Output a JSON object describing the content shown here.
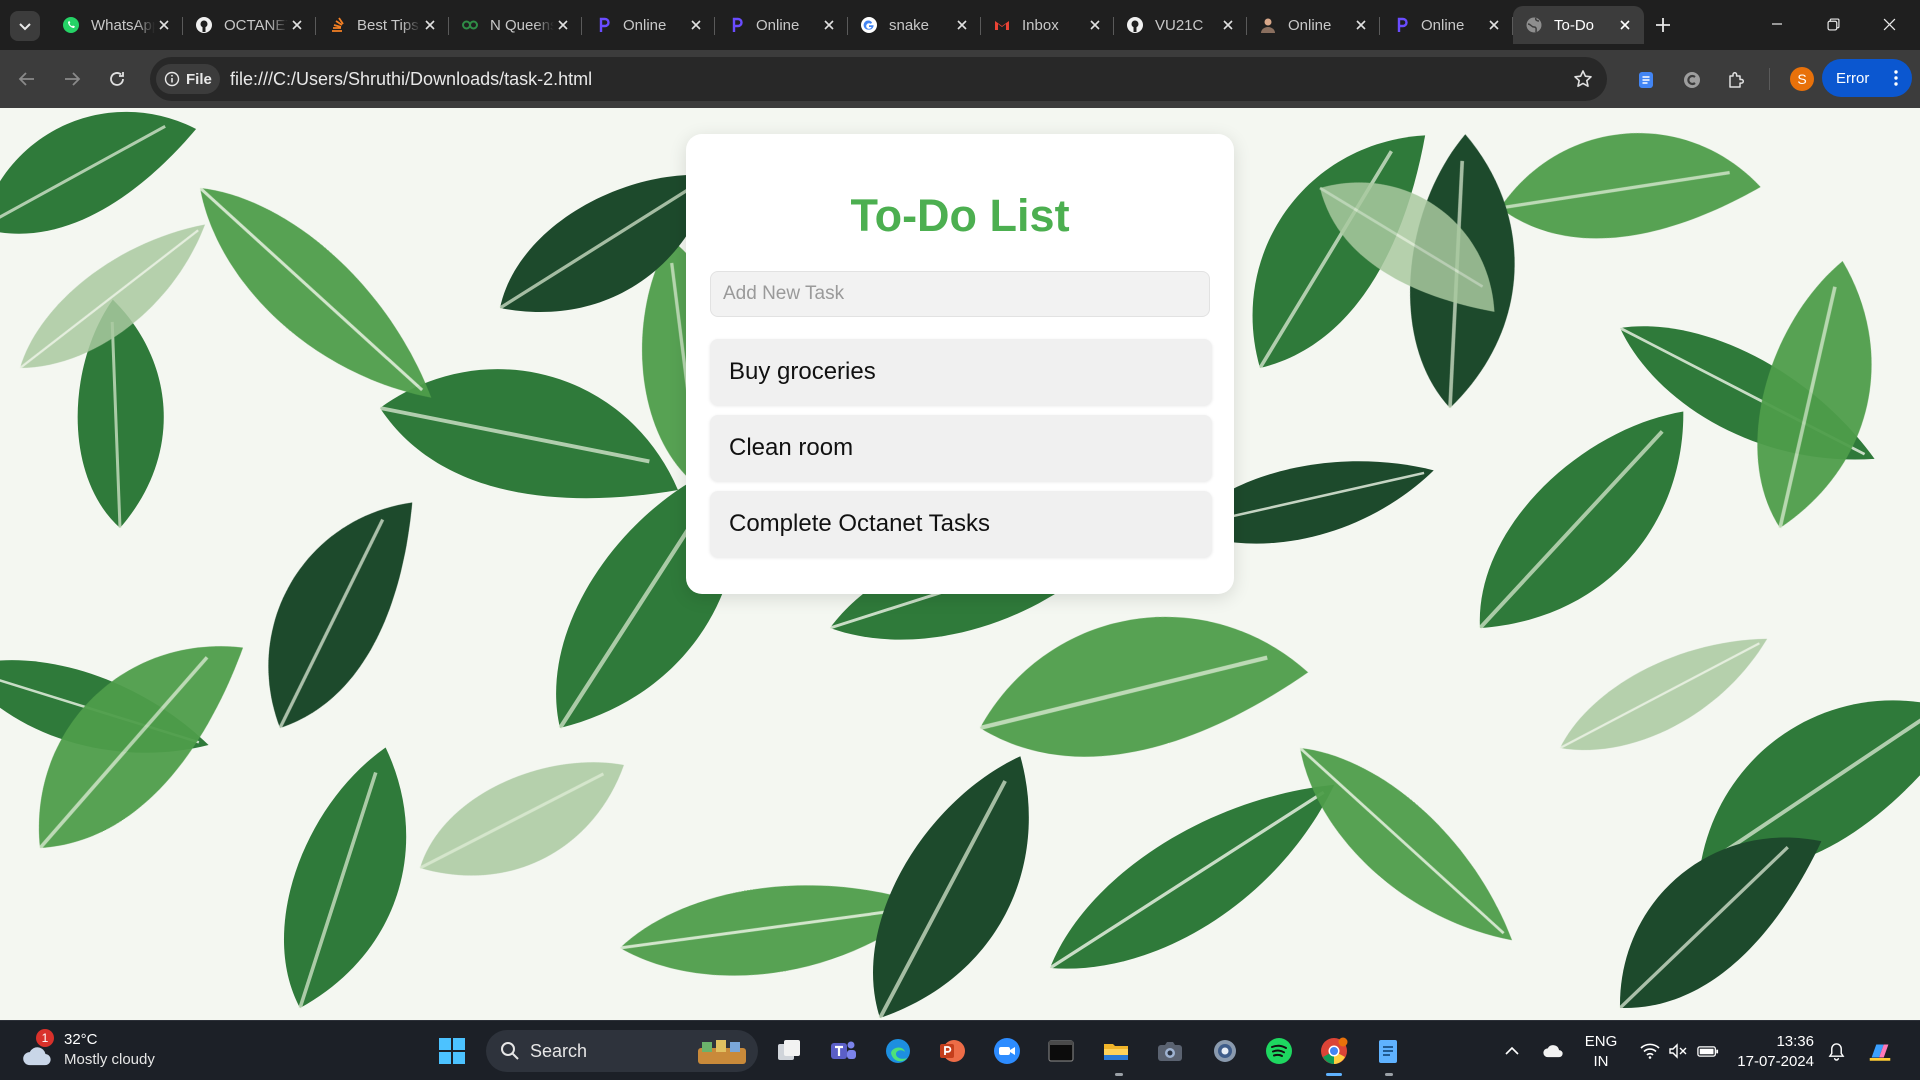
{
  "browser": {
    "tabs": [
      {
        "title": "WhatsApp",
        "icon": "whatsapp-icon",
        "active": false
      },
      {
        "title": "OCTANET",
        "icon": "github-icon",
        "active": false
      },
      {
        "title": "Best Tips",
        "icon": "stackoverflow-icon",
        "active": false
      },
      {
        "title": "N Queens",
        "icon": "gfg-icon",
        "active": false
      },
      {
        "title": "Online",
        "icon": "programiz-icon",
        "active": false
      },
      {
        "title": "Online",
        "icon": "programiz-icon",
        "active": false
      },
      {
        "title": "snake",
        "icon": "google-icon",
        "active": false
      },
      {
        "title": "Inbox",
        "icon": "gmail-icon",
        "active": false
      },
      {
        "title": "VU21C",
        "icon": "github-icon",
        "active": false
      },
      {
        "title": "Online",
        "icon": "person-icon",
        "active": false
      },
      {
        "title": "Online",
        "icon": "programiz-icon",
        "active": false
      },
      {
        "title": "To-Do",
        "icon": "globe-icon",
        "active": true
      }
    ],
    "address": {
      "chip_label": "File",
      "url": "file:///C:/Users/Shruthi/Downloads/task-2.html"
    },
    "profile_initial": "S",
    "error_label": "Error"
  },
  "page": {
    "title": "To-Do List",
    "input_placeholder": "Add New Task",
    "tasks": [
      "Buy groceries",
      "Clean room",
      "Complete Octanet Tasks"
    ]
  },
  "taskbar": {
    "weather": {
      "temp": "32°C",
      "desc": "Mostly cloudy",
      "badge": "1"
    },
    "search_label": "Search",
    "lang_line1": "ENG",
    "lang_line2": "IN",
    "time": "13:36",
    "date": "17-07-2024"
  },
  "colors": {
    "title_green": "#4caf50",
    "accent_blue": "#0b57d0",
    "profile_orange": "#e8710a"
  }
}
